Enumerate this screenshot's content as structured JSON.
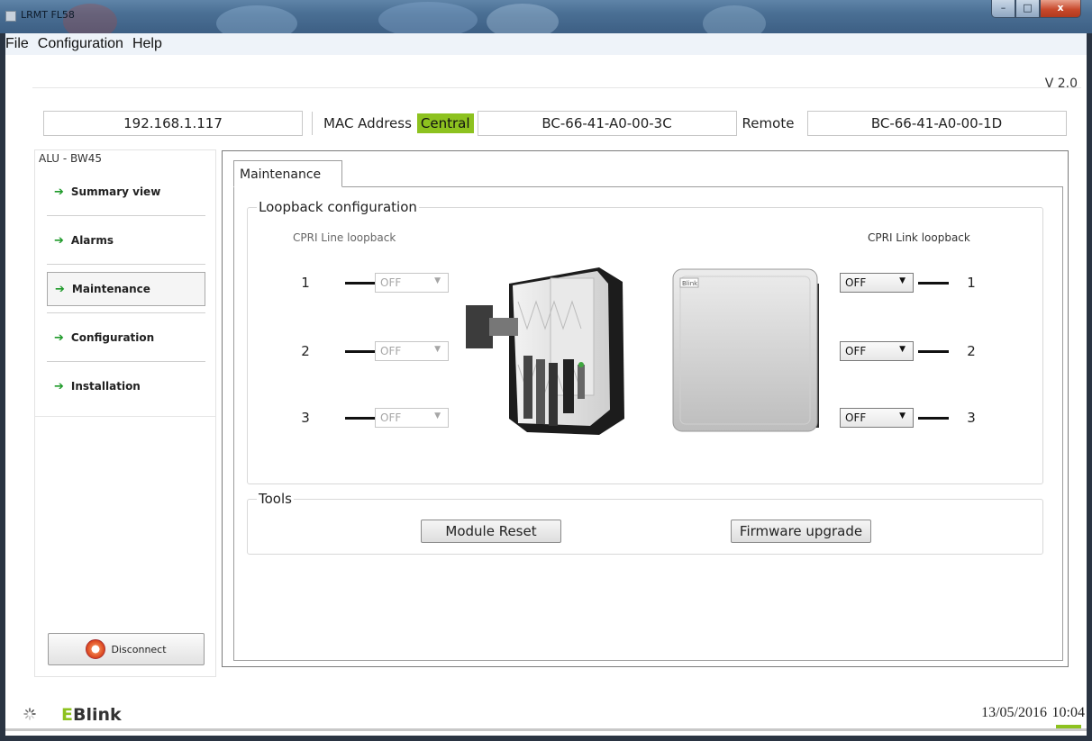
{
  "window": {
    "title": "LRMT FL58",
    "controls": {
      "minimize": "–",
      "maximize": "□",
      "close": "x"
    }
  },
  "menu": {
    "items": [
      "File",
      "Configuration",
      "Help"
    ]
  },
  "version": "V 2.0",
  "connection": {
    "ip": "192.168.1.117",
    "mac_label": "MAC Address",
    "central_label": "Central",
    "central_mac": "BC-66-41-A0-00-3C",
    "remote_label": "Remote",
    "remote_mac": "BC-66-41-A0-00-1D",
    "central_color": "#8dc21f"
  },
  "sidebar": {
    "header": "ALU - BW45",
    "items": [
      {
        "label": "Summary view"
      },
      {
        "label": "Alarms"
      },
      {
        "label": "Maintenance",
        "active": true
      },
      {
        "label": "Configuration"
      },
      {
        "label": "Installation"
      }
    ],
    "disconnect_label": "Disconnect"
  },
  "main": {
    "tab": "Maintenance",
    "loopback": {
      "title": "Loopback configuration",
      "line_label": "CPRI Line loopback",
      "link_label": "CPRI Link loopback",
      "line_ports": [
        {
          "num": "1",
          "value": "OFF"
        },
        {
          "num": "2",
          "value": "OFF"
        },
        {
          "num": "3",
          "value": "OFF"
        }
      ],
      "link_ports": [
        {
          "num": "1",
          "value": "OFF"
        },
        {
          "num": "2",
          "value": "OFF"
        },
        {
          "num": "3",
          "value": "OFF"
        }
      ],
      "device_brand": "Blink"
    },
    "tools": {
      "title": "Tools",
      "reset_label": "Module Reset",
      "firmware_label": "Firmware upgrade"
    }
  },
  "status": {
    "logo": "EBlink",
    "date": "13/05/2016",
    "time": "10:04",
    "accent_color": "#8dc21f"
  }
}
